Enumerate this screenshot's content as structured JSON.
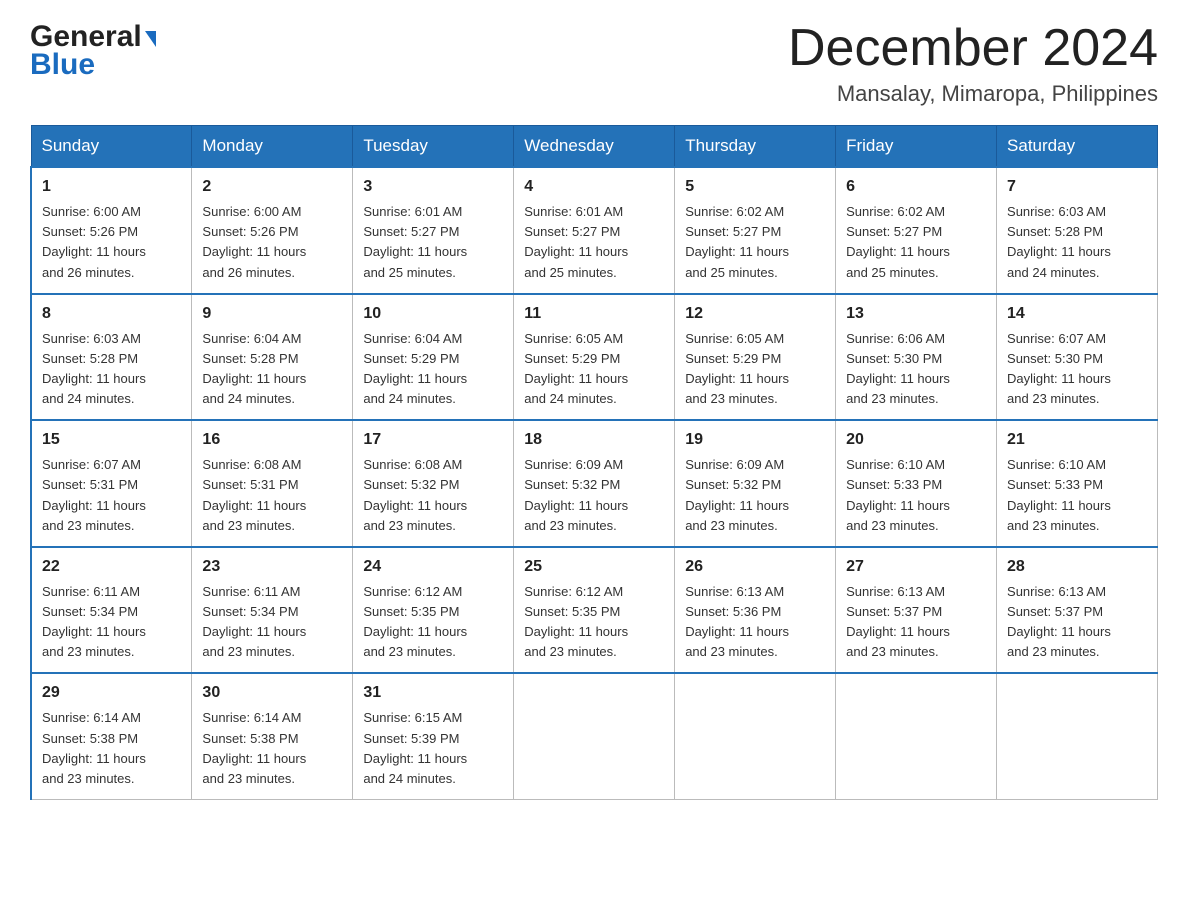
{
  "logo": {
    "line1": "General",
    "line2": "Blue"
  },
  "header": {
    "month": "December 2024",
    "location": "Mansalay, Mimaropa, Philippines"
  },
  "days_of_week": [
    "Sunday",
    "Monday",
    "Tuesday",
    "Wednesday",
    "Thursday",
    "Friday",
    "Saturday"
  ],
  "weeks": [
    [
      {
        "day": "1",
        "sunrise": "6:00 AM",
        "sunset": "5:26 PM",
        "daylight": "11 hours and 26 minutes."
      },
      {
        "day": "2",
        "sunrise": "6:00 AM",
        "sunset": "5:26 PM",
        "daylight": "11 hours and 26 minutes."
      },
      {
        "day": "3",
        "sunrise": "6:01 AM",
        "sunset": "5:27 PM",
        "daylight": "11 hours and 25 minutes."
      },
      {
        "day": "4",
        "sunrise": "6:01 AM",
        "sunset": "5:27 PM",
        "daylight": "11 hours and 25 minutes."
      },
      {
        "day": "5",
        "sunrise": "6:02 AM",
        "sunset": "5:27 PM",
        "daylight": "11 hours and 25 minutes."
      },
      {
        "day": "6",
        "sunrise": "6:02 AM",
        "sunset": "5:27 PM",
        "daylight": "11 hours and 25 minutes."
      },
      {
        "day": "7",
        "sunrise": "6:03 AM",
        "sunset": "5:28 PM",
        "daylight": "11 hours and 24 minutes."
      }
    ],
    [
      {
        "day": "8",
        "sunrise": "6:03 AM",
        "sunset": "5:28 PM",
        "daylight": "11 hours and 24 minutes."
      },
      {
        "day": "9",
        "sunrise": "6:04 AM",
        "sunset": "5:28 PM",
        "daylight": "11 hours and 24 minutes."
      },
      {
        "day": "10",
        "sunrise": "6:04 AM",
        "sunset": "5:29 PM",
        "daylight": "11 hours and 24 minutes."
      },
      {
        "day": "11",
        "sunrise": "6:05 AM",
        "sunset": "5:29 PM",
        "daylight": "11 hours and 24 minutes."
      },
      {
        "day": "12",
        "sunrise": "6:05 AM",
        "sunset": "5:29 PM",
        "daylight": "11 hours and 23 minutes."
      },
      {
        "day": "13",
        "sunrise": "6:06 AM",
        "sunset": "5:30 PM",
        "daylight": "11 hours and 23 minutes."
      },
      {
        "day": "14",
        "sunrise": "6:07 AM",
        "sunset": "5:30 PM",
        "daylight": "11 hours and 23 minutes."
      }
    ],
    [
      {
        "day": "15",
        "sunrise": "6:07 AM",
        "sunset": "5:31 PM",
        "daylight": "11 hours and 23 minutes."
      },
      {
        "day": "16",
        "sunrise": "6:08 AM",
        "sunset": "5:31 PM",
        "daylight": "11 hours and 23 minutes."
      },
      {
        "day": "17",
        "sunrise": "6:08 AM",
        "sunset": "5:32 PM",
        "daylight": "11 hours and 23 minutes."
      },
      {
        "day": "18",
        "sunrise": "6:09 AM",
        "sunset": "5:32 PM",
        "daylight": "11 hours and 23 minutes."
      },
      {
        "day": "19",
        "sunrise": "6:09 AM",
        "sunset": "5:32 PM",
        "daylight": "11 hours and 23 minutes."
      },
      {
        "day": "20",
        "sunrise": "6:10 AM",
        "sunset": "5:33 PM",
        "daylight": "11 hours and 23 minutes."
      },
      {
        "day": "21",
        "sunrise": "6:10 AM",
        "sunset": "5:33 PM",
        "daylight": "11 hours and 23 minutes."
      }
    ],
    [
      {
        "day": "22",
        "sunrise": "6:11 AM",
        "sunset": "5:34 PM",
        "daylight": "11 hours and 23 minutes."
      },
      {
        "day": "23",
        "sunrise": "6:11 AM",
        "sunset": "5:34 PM",
        "daylight": "11 hours and 23 minutes."
      },
      {
        "day": "24",
        "sunrise": "6:12 AM",
        "sunset": "5:35 PM",
        "daylight": "11 hours and 23 minutes."
      },
      {
        "day": "25",
        "sunrise": "6:12 AM",
        "sunset": "5:35 PM",
        "daylight": "11 hours and 23 minutes."
      },
      {
        "day": "26",
        "sunrise": "6:13 AM",
        "sunset": "5:36 PM",
        "daylight": "11 hours and 23 minutes."
      },
      {
        "day": "27",
        "sunrise": "6:13 AM",
        "sunset": "5:37 PM",
        "daylight": "11 hours and 23 minutes."
      },
      {
        "day": "28",
        "sunrise": "6:13 AM",
        "sunset": "5:37 PM",
        "daylight": "11 hours and 23 minutes."
      }
    ],
    [
      {
        "day": "29",
        "sunrise": "6:14 AM",
        "sunset": "5:38 PM",
        "daylight": "11 hours and 23 minutes."
      },
      {
        "day": "30",
        "sunrise": "6:14 AM",
        "sunset": "5:38 PM",
        "daylight": "11 hours and 23 minutes."
      },
      {
        "day": "31",
        "sunrise": "6:15 AM",
        "sunset": "5:39 PM",
        "daylight": "11 hours and 24 minutes."
      },
      null,
      null,
      null,
      null
    ]
  ],
  "labels": {
    "sunrise": "Sunrise:",
    "sunset": "Sunset:",
    "daylight": "Daylight:"
  }
}
